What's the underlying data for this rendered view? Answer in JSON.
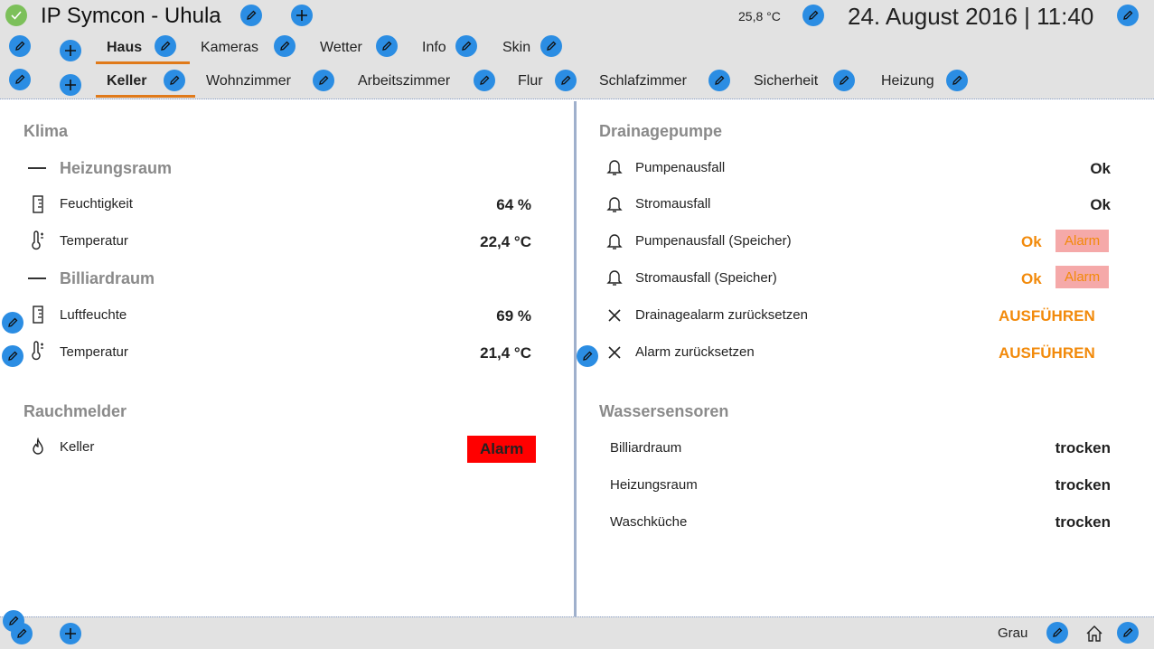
{
  "header": {
    "title": "IP Symcon - Uhula",
    "temperature": "25,8 °C",
    "datetime": "24. August 2016 | 11:40"
  },
  "tabs_row1": [
    "Haus",
    "Kameras",
    "Wetter",
    "Info",
    "Skin"
  ],
  "tabs_row2": [
    "Keller",
    "Wohnzimmer",
    "Arbeitszimmer",
    "Flur",
    "Schlafzimmer",
    "Sicherheit",
    "Heizung"
  ],
  "left": {
    "klima_title": "Klima",
    "heizungsraum_title": "Heizungsraum",
    "heizungsraum": [
      {
        "label": "Feuchtigkeit",
        "value": "64 %",
        "icon": "hygrometer-icon"
      },
      {
        "label": "Temperatur",
        "value": "22,4 °C",
        "icon": "thermometer-icon"
      }
    ],
    "billiardraum_title": "Billiardraum",
    "billiardraum": [
      {
        "label": "Luftfeuchte",
        "value": "69 %",
        "icon": "hygrometer-icon"
      },
      {
        "label": "Temperatur",
        "value": "21,4 °C",
        "icon": "thermometer-icon"
      }
    ],
    "rauchmelder_title": "Rauchmelder",
    "rauchmelder": [
      {
        "label": "Keller",
        "value": "Alarm",
        "icon": "flame-icon"
      }
    ]
  },
  "right": {
    "drainage_title": "Drainagepumpe",
    "drainage": [
      {
        "label": "Pumpenausfall",
        "value": "Ok"
      },
      {
        "label": "Stromausfall",
        "value": "Ok"
      },
      {
        "label": "Pumpenausfall (Speicher)",
        "value": "Ok",
        "badge": "Alarm"
      },
      {
        "label": "Stromausfall (Speicher)",
        "value": "Ok",
        "badge": "Alarm"
      },
      {
        "label": "Drainagealarm zurücksetzen",
        "value": "AUSFÜHREN"
      },
      {
        "label": "Alarm zurücksetzen",
        "value": "AUSFÜHREN"
      }
    ],
    "wasser_title": "Wassersensoren",
    "wasser": [
      {
        "label": "Billiardraum",
        "value": "trocken"
      },
      {
        "label": "Heizungsraum",
        "value": "trocken"
      },
      {
        "label": "Waschküche",
        "value": "trocken"
      }
    ]
  },
  "footer": {
    "skin_label": "Grau"
  },
  "colors": {
    "accent": "#2b8de3",
    "tab_underline": "#e07a1a",
    "orange": "#f28a0b",
    "alarm_red": "#ff0000",
    "alarm_light": "#f5a9a9",
    "bar_bg": "#e2e2e2"
  }
}
